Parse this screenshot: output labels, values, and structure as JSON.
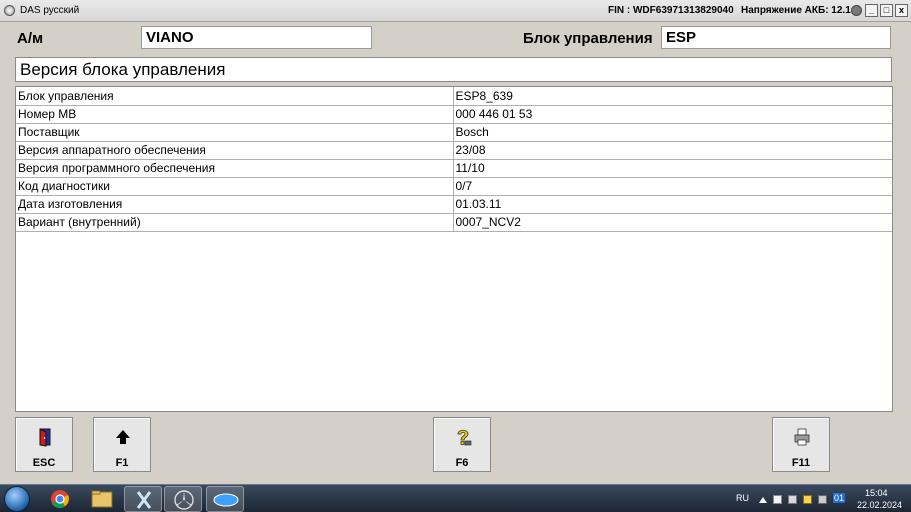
{
  "window": {
    "title": "DAS русский",
    "fin": "FIN : WDF63971313829040",
    "battery": "Напряжение АКБ: 12.1 V",
    "minimize": "_",
    "maximize": "□",
    "close": "x"
  },
  "header": {
    "model_label": "А/м",
    "model_value": "VIANO",
    "unit_label": "Блок управления",
    "unit_value": "ESP"
  },
  "section_title": "Версия блока управления",
  "table": {
    "rows": [
      {
        "key": "Блок управления",
        "value": "ESP8_639"
      },
      {
        "key": "Номер MB",
        "value": "000 446 01 53"
      },
      {
        "key": "Поставщик",
        "value": "Bosch"
      },
      {
        "key": "Версия аппаратного обеспечения",
        "value": "23/08"
      },
      {
        "key": "Версия программного обеспечения",
        "value": "11/10"
      },
      {
        "key": "Код диагностики",
        "value": "0/7"
      },
      {
        "key": "Дата изготовления",
        "value": "01.03.11"
      },
      {
        "key": "Вариант (внутренний)",
        "value": "0007_NCV2"
      }
    ]
  },
  "buttons": {
    "esc": "ESC",
    "f1": "F1",
    "f6": "F6",
    "f11": "F11"
  },
  "icons": {
    "esc": "exit-door-icon",
    "f1": "arrow-up-icon",
    "f6": "help-question-icon",
    "f11": "printer-icon"
  },
  "taskbar": {
    "language": "RU",
    "time": "15:04",
    "date": "22.02.2024",
    "tray_badge": "01"
  },
  "colors": {
    "window_bg": "#d4d0c8",
    "field_bg": "#ffffff",
    "taskbar_bg": "#1d2633"
  }
}
